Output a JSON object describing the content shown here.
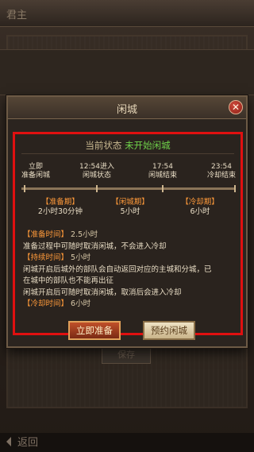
{
  "background": {
    "title": "君主",
    "back_label": "返回",
    "hidden_button": "保存"
  },
  "dialog": {
    "title": "闲城",
    "close_icon": "close-icon",
    "status_prefix": "当前状态 ",
    "status_value": "未开始闲城",
    "timeline": [
      {
        "line1": "立即",
        "line2": "准备闲城"
      },
      {
        "line1": "12:54进入",
        "line2": "闲城状态"
      },
      {
        "line1": "17:54",
        "line2": "闲城结束"
      },
      {
        "line1": "23:54",
        "line2": "冷却结束"
      }
    ],
    "phases": [
      {
        "name": "【准备期】",
        "duration": "2小时30分钟"
      },
      {
        "name": "【闲城期】",
        "duration": "5小时"
      },
      {
        "name": "【冷却期】",
        "duration": "6小时"
      }
    ],
    "desc": {
      "prep_head": "【准备时间】",
      "prep_val": "2.5小时",
      "prep_text": "准备过程中可随时取消闲城，不会进入冷却",
      "dur_head": "【持续时间】",
      "dur_val": "5小时",
      "dur_text1": "闲城开启后城外的部队会自动返回对应的主城和分城，已",
      "dur_text2": "在城中的部队也不能再出征",
      "dur_text3": "闲城开启后可随时取消闲城，取消后会进入冷却",
      "cool_head": "【冷却时间】",
      "cool_val": "6小时"
    },
    "buttons": {
      "prepare": "立即准备",
      "reserve": "预约闲城"
    }
  },
  "colors": {
    "highlight_border": "#e01010",
    "status_green": "#6fd24a",
    "phase_orange": "#ff9a3a"
  }
}
